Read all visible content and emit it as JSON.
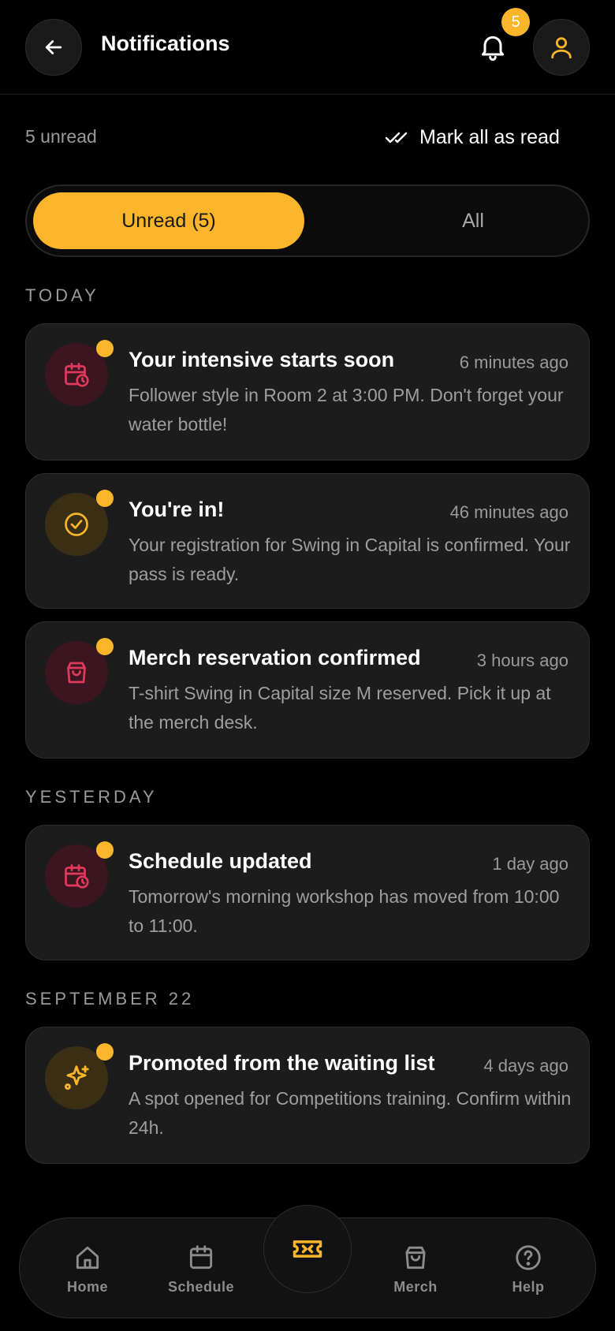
{
  "header": {
    "title": "Notifications",
    "back_icon": "arrow-left-icon",
    "bell_icon": "bell-icon",
    "bell_badge": "5",
    "profile_icon": "user-icon"
  },
  "summary": {
    "unread_text": "5 unread",
    "mark_all_label": "Mark all as read",
    "mark_all_icon": "double-check-icon"
  },
  "tabs": [
    {
      "label": "Unread (5)",
      "active": true
    },
    {
      "label": "All",
      "active": false
    }
  ],
  "sections": [
    {
      "heading": "TODAY",
      "items": [
        {
          "icon": "calendar-clock-icon",
          "title": "Your intensive starts soon",
          "time": "6 minutes ago",
          "body": "Follower style in Room 2 at 3:00 PM. Don't forget your water bottle!",
          "unread": true
        },
        {
          "icon": "check-circle-icon",
          "title": "You're in!",
          "time": "46 minutes ago",
          "body": "Your registration for Swing in Capital is confirmed. Your pass is ready.",
          "unread": true
        },
        {
          "icon": "shopping-bag-icon",
          "title": "Merch reservation confirmed",
          "time": "3 hours ago",
          "body": "T-shirt Swing in Capital size M reserved. Pick it up at the merch desk.",
          "unread": true
        }
      ]
    },
    {
      "heading": "YESTERDAY",
      "items": [
        {
          "icon": "calendar-clock-icon",
          "title": "Schedule updated",
          "time": "1 day ago",
          "body": "Tomorrow's morning workshop has moved from 10:00 to 11:00.",
          "unread": true
        }
      ]
    },
    {
      "heading": "SEPTEMBER 22",
      "items": [
        {
          "icon": "sparkles-icon",
          "title": "Promoted from the waiting list",
          "time": "4 days ago",
          "body": "A spot opened for Competitions training. Confirm within 24h.",
          "unread": true
        }
      ]
    }
  ],
  "nav": {
    "items": [
      {
        "label": "Home",
        "icon": "home-icon"
      },
      {
        "label": "Schedule",
        "icon": "calendar-icon"
      },
      {
        "label": "Merch",
        "icon": "shopping-bag-icon"
      },
      {
        "label": "Help",
        "icon": "help-circle-icon"
      }
    ],
    "center_icon": "ticket-icon"
  },
  "colors": {
    "accent": "#fbb52a",
    "card_bg": "#1c1c1c",
    "background": "#000000",
    "icon_red": "#e0395b",
    "icon_amber": "#fbb52a"
  }
}
